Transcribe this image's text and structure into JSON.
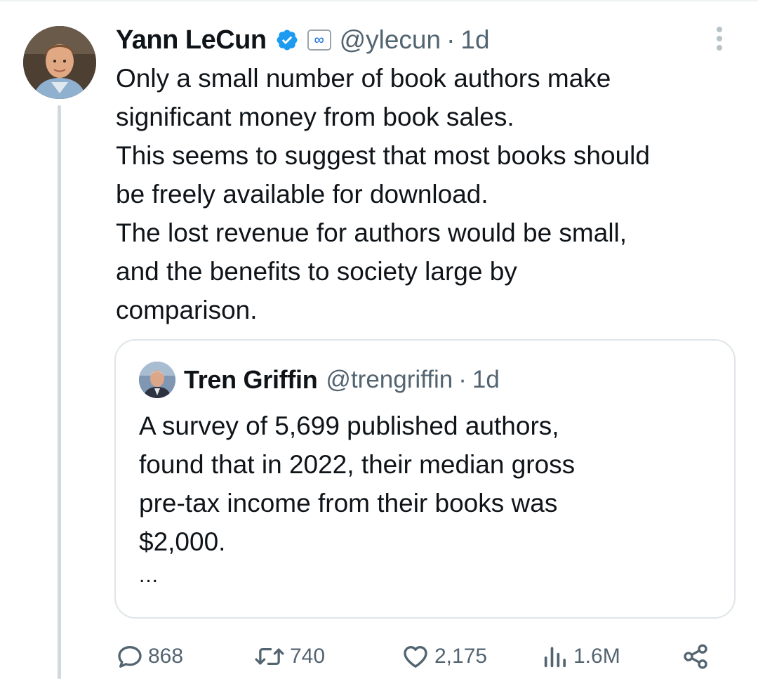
{
  "tweet": {
    "author_name": "Yann LeCun",
    "handle": "@ylecun",
    "separator": "·",
    "time": "1d",
    "affiliation_badge": "∞",
    "text_lines": [
      "Only a small number of book authors make",
      "significant money from book sales.",
      "This seems to suggest that most books should",
      "be freely available for download.",
      "The lost revenue for authors would be small,",
      "and the benefits to society large by",
      "comparison."
    ]
  },
  "quoted_tweet": {
    "author_name": "Tren Griffin",
    "handle": "@trengriffin",
    "separator": "·",
    "time": "1d",
    "text_lines": [
      "A survey of 5,699 published authors,",
      "found that in 2022, their median gross",
      "pre-tax income from their books was",
      "$2,000."
    ],
    "truncation": "..."
  },
  "actions": {
    "replies": "868",
    "reposts": "740",
    "likes": "2,175",
    "views": "1.6M"
  },
  "colors": {
    "verified_blue": "#1d9bf0",
    "meta_blue": "#0668e1",
    "secondary_text": "#536471",
    "thread_line": "#cfd9de"
  },
  "icons": [
    "verified-badge-icon",
    "meta-affiliation-icon",
    "more-options-icon",
    "reply-icon",
    "repost-icon",
    "like-icon",
    "views-icon",
    "share-icon"
  ]
}
